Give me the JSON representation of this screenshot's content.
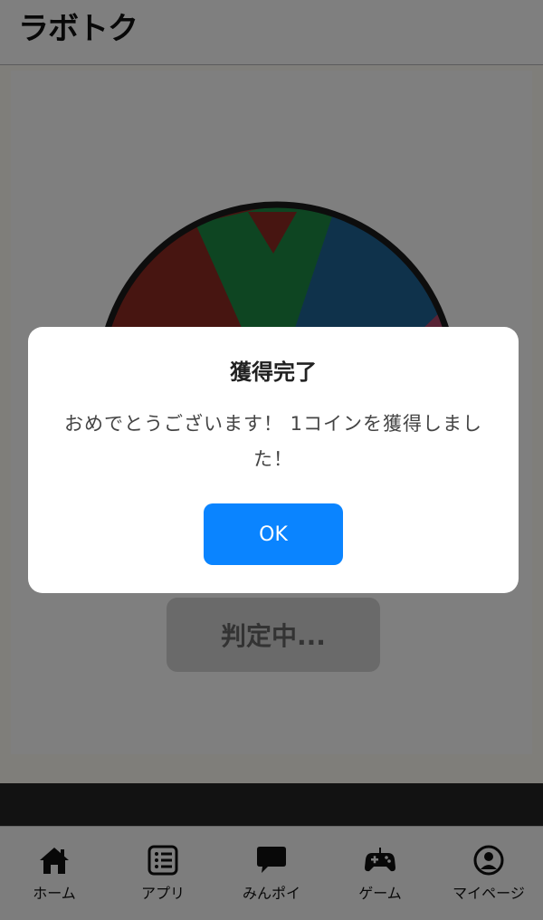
{
  "header": {
    "logo_text": "ラボトク"
  },
  "main": {
    "judge_button_label": "判定中...",
    "wheel": {
      "segment_colors": [
        "#8f2a22",
        "#1c8a45",
        "#8f2a22",
        "#1f6496",
        "#b0466b"
      ],
      "rim_color": "#1a1a1a"
    }
  },
  "nav": {
    "items": [
      {
        "label": "ホーム",
        "icon": "home-icon"
      },
      {
        "label": "アプリ",
        "icon": "list-icon"
      },
      {
        "label": "みんポイ",
        "icon": "chat-bubble-icon"
      },
      {
        "label": "ゲーム",
        "icon": "gamepad-icon"
      },
      {
        "label": "マイページ",
        "icon": "user-icon"
      }
    ]
  },
  "dialog": {
    "title": "獲得完了",
    "message": "おめでとうございます！ 1コインを獲得しました！",
    "ok_label": "OK"
  },
  "colors": {
    "accent": "#0a84ff",
    "overlay": "rgba(0,0,0,0.5)"
  }
}
